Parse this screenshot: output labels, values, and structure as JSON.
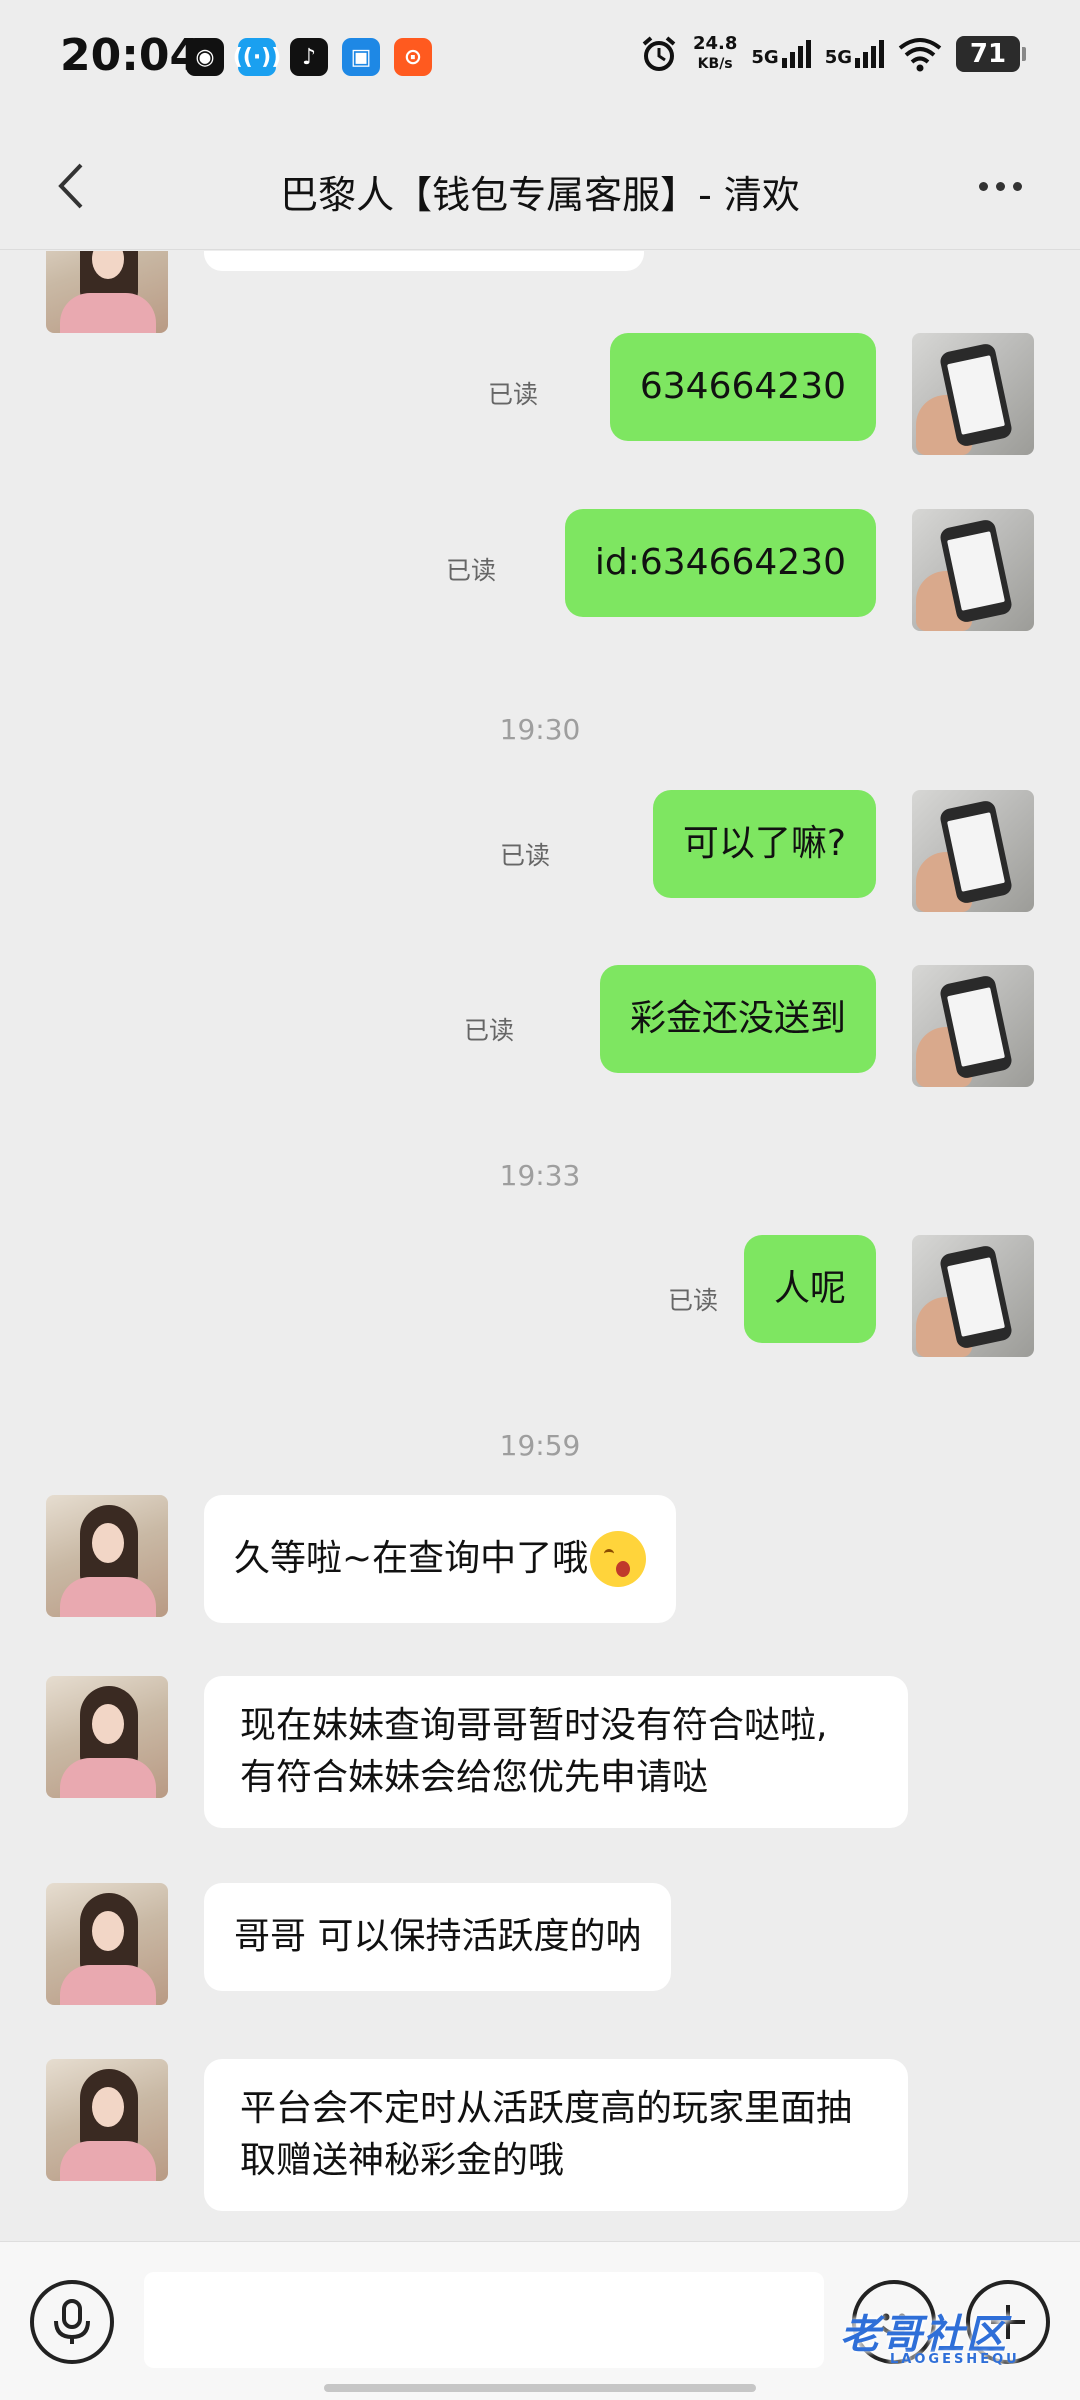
{
  "status_bar": {
    "time": "20:04",
    "net_speed_value": "24.8",
    "net_speed_unit": "KB/s",
    "signal1": "5G",
    "signal2": "5G",
    "battery": "71",
    "apps": [
      "qq-icon",
      "wifi-helper-icon",
      "tiktok-icon",
      "message-app-icon",
      "kuaishou-icon"
    ]
  },
  "header": {
    "title": "巴黎人【钱包专属客服】- 清欢"
  },
  "chat": {
    "read_label": "已读",
    "messages": [
      {
        "from": "me",
        "text": "634664230",
        "read": "已读"
      },
      {
        "from": "me",
        "text": "id:634664230",
        "read": "已读"
      },
      {
        "type": "time",
        "text": "19:30"
      },
      {
        "from": "me",
        "text": "可以了嘛?",
        "read": "已读"
      },
      {
        "from": "me",
        "text": "彩金还没送到",
        "read": "已读"
      },
      {
        "type": "time",
        "text": "19:33"
      },
      {
        "from": "me",
        "text": "人呢",
        "read": "已读"
      },
      {
        "type": "time",
        "text": "19:59"
      },
      {
        "from": "her",
        "text": "久等啦~在查询中了哦",
        "emoji": "yawning-face-emoji"
      },
      {
        "from": "her",
        "lines": [
          "现在妹妹查询哥哥暂时没有符合哒啦,",
          "有符合妹妹会给您优先申请哒"
        ]
      },
      {
        "from": "her",
        "text": "哥哥 可以保持活跃度的呐"
      },
      {
        "from": "her",
        "lines": [
          "平台会不定时从活跃度高的玩家里面抽",
          "取赠送神秘彩金的哦"
        ]
      }
    ]
  },
  "input_bar": {
    "value": "",
    "placeholder": ""
  },
  "watermark": {
    "text": "老哥社区",
    "sub": "LAOGESHEQU"
  },
  "colors": {
    "my_bubble": "#7ee661",
    "her_bubble": "#ffffff",
    "background": "#ededed"
  }
}
